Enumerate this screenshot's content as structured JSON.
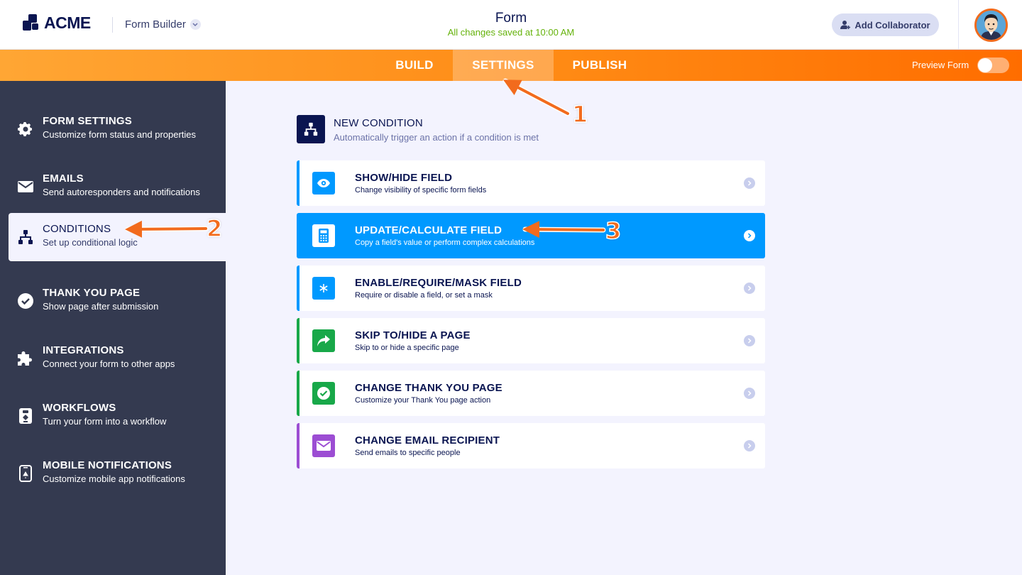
{
  "header": {
    "logo_text": "ACME",
    "builder_name": "Form Builder",
    "form_title": "Form",
    "save_status": "All changes saved at 10:00 AM",
    "collaborator_button": "Add Collaborator"
  },
  "nav": {
    "tabs": [
      {
        "label": "BUILD"
      },
      {
        "label": "SETTINGS"
      },
      {
        "label": "PUBLISH"
      }
    ],
    "active_tab": "SETTINGS",
    "preview_label": "Preview Form",
    "preview_enabled": false
  },
  "sidebar": {
    "items": [
      {
        "title": "FORM SETTINGS",
        "subtitle": "Customize form status and properties",
        "icon": "gear-icon"
      },
      {
        "title": "EMAILS",
        "subtitle": "Send autoresponders and notifications",
        "icon": "envelope-icon"
      },
      {
        "title": "CONDITIONS",
        "subtitle": "Set up conditional logic",
        "icon": "hierarchy-icon"
      },
      {
        "title": "THANK YOU PAGE",
        "subtitle": "Show page after submission",
        "icon": "check-circle-icon"
      },
      {
        "title": "INTEGRATIONS",
        "subtitle": "Connect your form to other apps",
        "icon": "puzzle-icon"
      },
      {
        "title": "WORKFLOWS",
        "subtitle": "Turn your form into a workflow",
        "icon": "workflow-icon"
      },
      {
        "title": "MOBILE NOTIFICATIONS",
        "subtitle": "Customize mobile app notifications",
        "icon": "mobile-icon"
      }
    ],
    "active_item": "CONDITIONS"
  },
  "main": {
    "heading": "NEW CONDITION",
    "subheading": "Automatically trigger an action if a condition is met",
    "conditions": [
      {
        "title": "SHOW/HIDE FIELD",
        "subtitle": "Change visibility of specific form fields",
        "icon": "eye-icon",
        "color": "#0099ff"
      },
      {
        "title": "UPDATE/CALCULATE FIELD",
        "subtitle": "Copy a field's value or perform complex calculations",
        "icon": "calculator-icon",
        "color": "#0099ff"
      },
      {
        "title": "ENABLE/REQUIRE/MASK FIELD",
        "subtitle": "Require or disable a field, or set a mask",
        "icon": "asterisk-icon",
        "color": "#0099ff"
      },
      {
        "title": "SKIP TO/HIDE A PAGE",
        "subtitle": "Skip to or hide a specific page",
        "icon": "share-arrow-icon",
        "color": "#18a849"
      },
      {
        "title": "CHANGE THANK YOU PAGE",
        "subtitle": "Customize your Thank You page action",
        "icon": "check-circle-icon",
        "color": "#18a849"
      },
      {
        "title": "CHANGE EMAIL RECIPIENT",
        "subtitle": "Send emails to specific people",
        "icon": "envelope-icon",
        "color": "#9c4dd3"
      }
    ],
    "highlighted_condition": "UPDATE/CALCULATE FIELD"
  },
  "annotations": {
    "step_1": "1",
    "step_2": "2",
    "step_3": "3",
    "color": "#f26b1d"
  }
}
